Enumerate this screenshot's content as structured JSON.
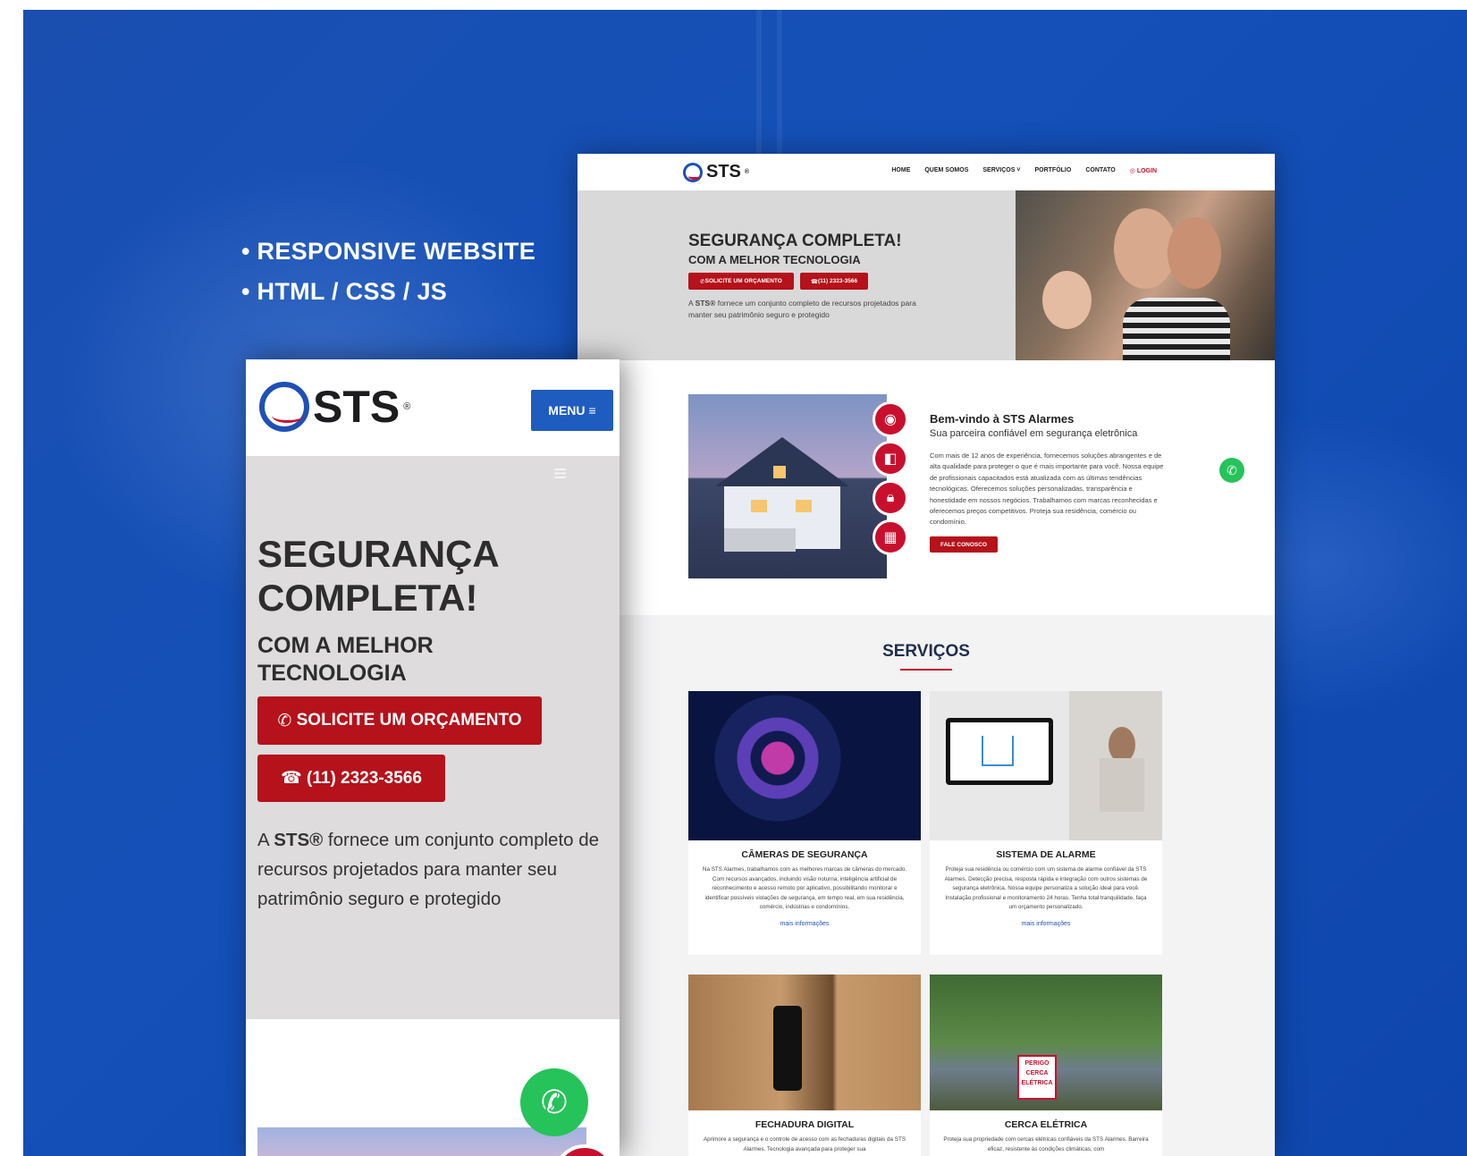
{
  "promo": {
    "bullets": [
      "• RESPONSIVE WEBSITE",
      "• HTML / CSS / JS"
    ]
  },
  "brand": {
    "name": "STS",
    "mark": "®"
  },
  "desktop": {
    "nav": [
      "HOME",
      "QUEM SOMOS",
      "SERVIÇOS ˅",
      "PORTFÓLIO",
      "CONTATO"
    ],
    "login": "LOGIN",
    "hero": {
      "title": "SEGURANÇA COMPLETA!",
      "subtitle": "COM A MELHOR TECNOLOGIA",
      "btn_quote": "SOLICITE UM ORÇAMENTO",
      "btn_phone": "(11) 2323-3566",
      "text_a": "A ",
      "text_b": "STS®",
      "text_c": " fornece um conjunto completo de recursos projetados para manter seu patrimônio seguro e protegido"
    },
    "welcome": {
      "title": "Bem-vindo à STS Alarmes",
      "subtitle": "Sua parceira confiável em segurança eletrônica",
      "text": "Com mais de 12 anos de experiência, fornecemos soluções abrangentes e de alta qualidade para proteger o que é mais importante para você. Nossa equipe de profissionais capacitados está atualizada com as últimas tendências tecnológicas. Oferecemos soluções personalizadas, transparência e honestidade em nossos negócios. Trabalhamos com marcas reconhecidas e oferecemos preços competitivos. Proteja sua residência, comércio ou condomínio.",
      "cta": "FALE CONOSCO"
    },
    "services": {
      "heading": "SERVIÇOS",
      "more": "mais informações",
      "cards": [
        {
          "title": "CÂMERAS DE SEGURANÇA",
          "text": "Na STS Alarmes, trabalhamos com as melhores marcas de câmeras do mercado. Com recursos avançados, incluindo visão noturna, inteligência artificial de reconhecimento e acesso remoto por aplicativo, possibilitando monitorar e identificar possíveis violações de segurança, em tempo real, em sua residência, comércio, indústrias e condomínios."
        },
        {
          "title": "SISTEMA DE ALARME",
          "text": "Proteja sua residência ou comércio com um sistema de alarme confiável da STS Alarmes. Detecção precisa, resposta rápida e integração com outros sistemas de segurança eletrônica. Nossa equipe personaliza a solução ideal para você. Instalação profissional e monitoramento 24 horas. Tenha total tranquilidade, faça um orçamento personalizado."
        },
        {
          "title": "FECHADURA DIGITAL",
          "text": "Aprimore a segurança e o controle de acesso com as fechaduras digitais da STS Alarmes. Tecnologia avançada para proteger sua"
        },
        {
          "title": "CERCA ELÉTRICA",
          "text": "Proteja sua propriedade com cercas elétricas confiáveis da STS Alarmes. Barreira eficaz, resistente às condições climáticas, com"
        }
      ]
    },
    "sign": [
      "PERIGO",
      "CERCA",
      "ELÉTRICA"
    ]
  },
  "mobile": {
    "menu": "MENU",
    "title_l1": "SEGURANÇA",
    "title_l2": "COMPLETA!",
    "sub_l1": "COM A MELHOR",
    "sub_l2": "TECNOLOGIA",
    "btn_quote": "SOLICITE UM ORÇAMENTO",
    "btn_phone": "(11) 2323-3566",
    "text_a": "A ",
    "text_b": "STS®",
    "text_c": " fornece um conjunto completo de recursos projetados para manter seu patrimônio seguro e protegido"
  },
  "colors": {
    "brand_blue": "#1f5cbf",
    "brand_red": "#b5121b",
    "whatsapp": "#25c35a"
  }
}
